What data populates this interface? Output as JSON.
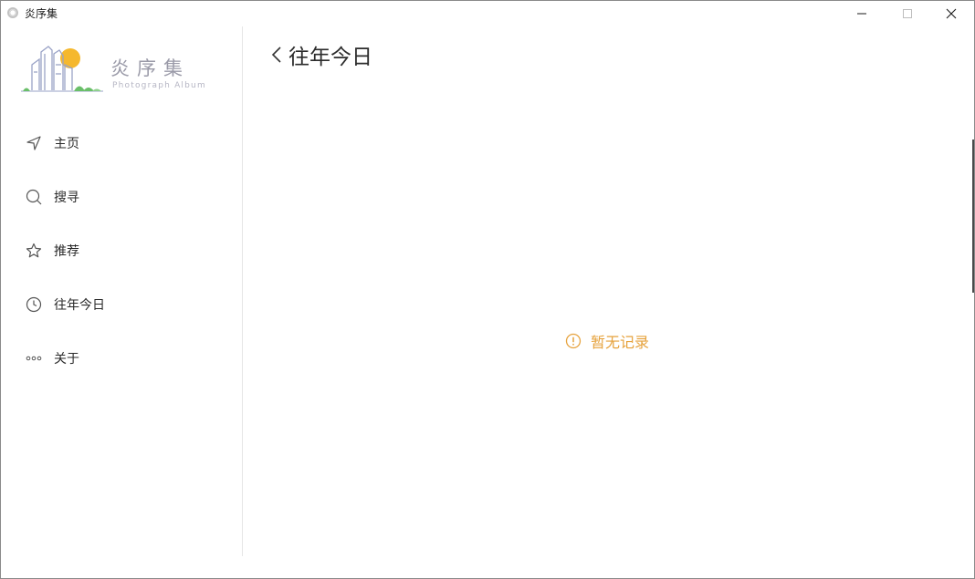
{
  "window": {
    "title": "炎序集",
    "controls": {
      "minimize_icon": "minimize-icon",
      "maximize_icon": "maximize-icon",
      "close_icon": "close-icon"
    }
  },
  "sidebar": {
    "logo": {
      "name_cn": "炎序集",
      "name_en": "Photograph Album",
      "colors": {
        "sun": "#f5b82e",
        "buildings": "#9aa3c7",
        "grass": "#6abf69"
      }
    },
    "items": [
      {
        "label": "主页",
        "icon": "navigation-arrow-icon"
      },
      {
        "label": "搜寻",
        "icon": "search-icon"
      },
      {
        "label": "推荐",
        "icon": "star-icon"
      },
      {
        "label": "往年今日",
        "icon": "clock-icon"
      },
      {
        "label": "关于",
        "icon": "more-dots-icon"
      }
    ]
  },
  "main": {
    "back_icon": "chevron-left-icon",
    "title": "往年今日",
    "empty": {
      "icon": "warning-circle-icon",
      "text": "暂无记录",
      "color": "#e6a23c"
    }
  }
}
